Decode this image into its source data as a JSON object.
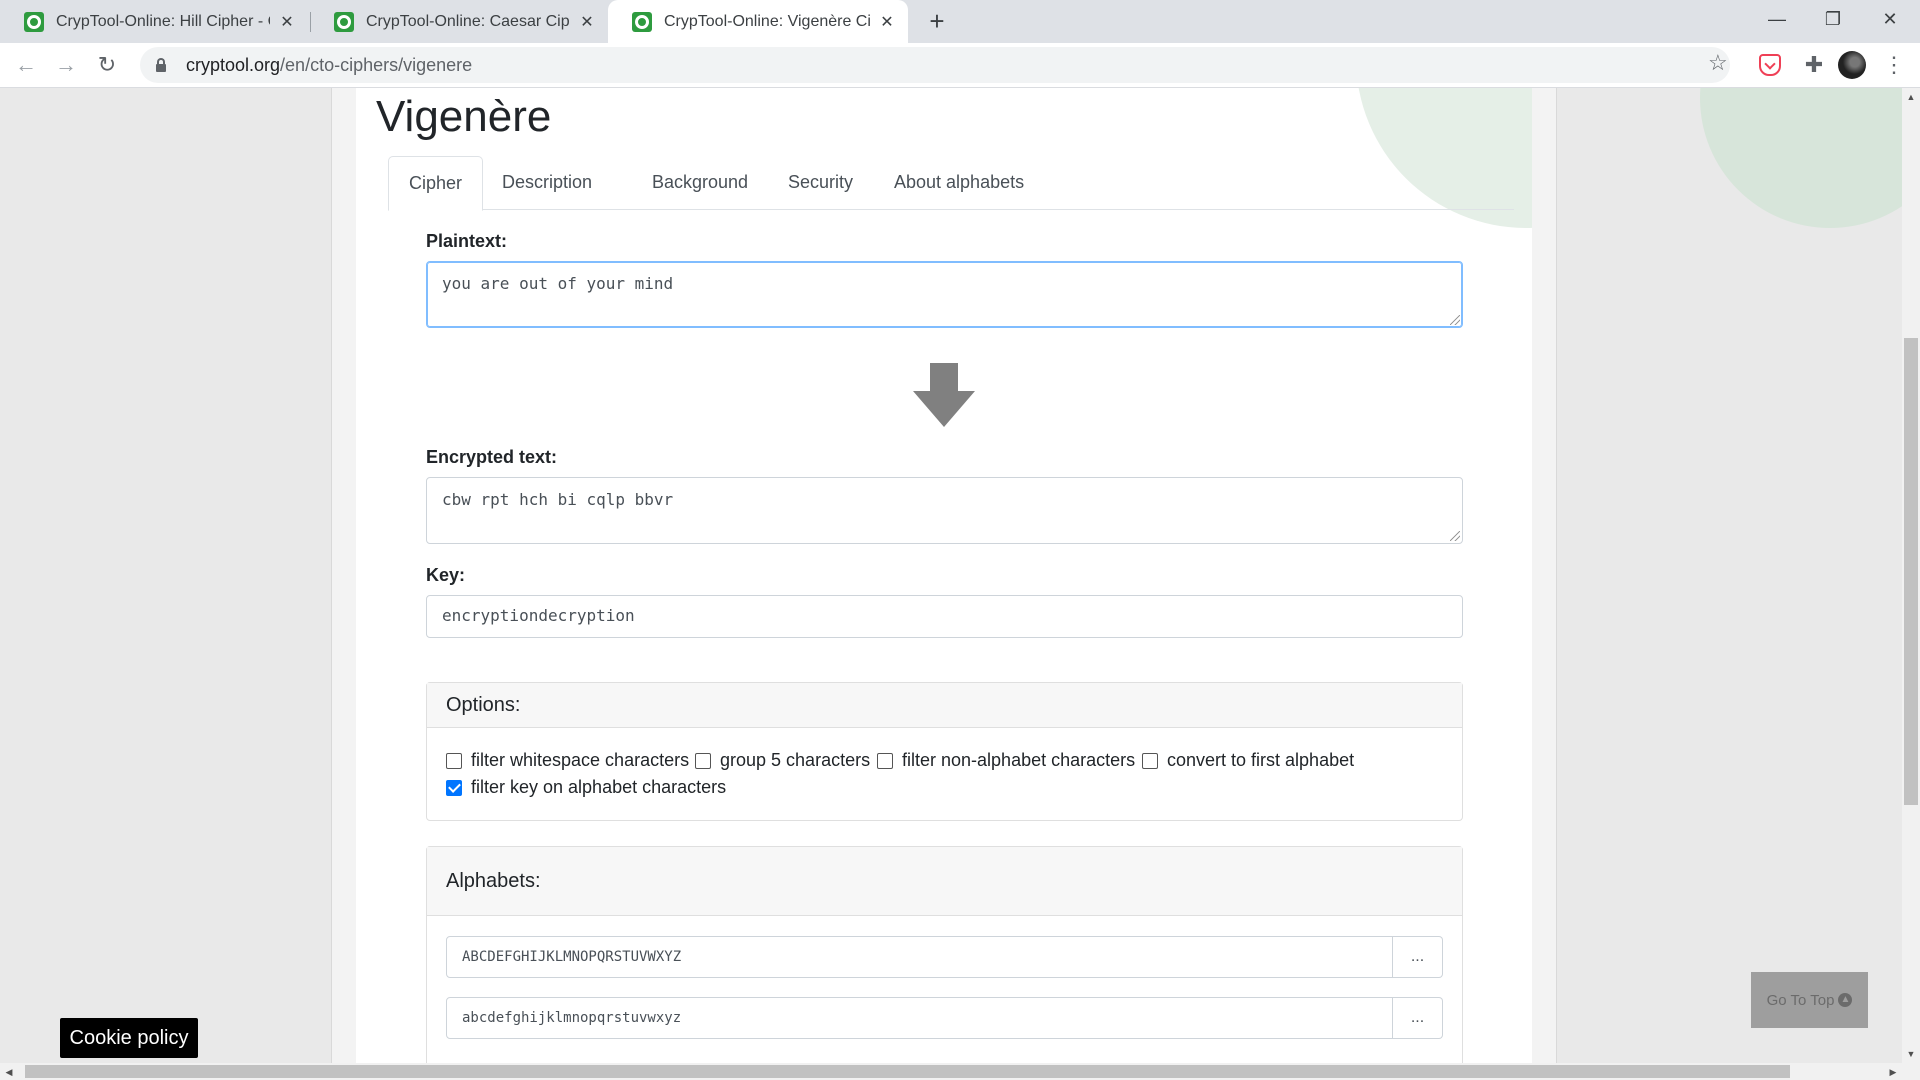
{
  "browser": {
    "tabs": [
      {
        "title": "CrypTool-Online: Hill Cipher - Cry"
      },
      {
        "title": "CrypTool-Online: Caesar Cipher -"
      },
      {
        "title": "CrypTool-Online: Vigenère Ciphe"
      }
    ],
    "new_tab": "+",
    "url_host": "cryptool.org",
    "url_path": "/en/cto-ciphers/vigenere",
    "window_controls": {
      "minimize": "—",
      "restore": "❐",
      "close": "✕"
    }
  },
  "page": {
    "heading": "Vigenère",
    "tabs": [
      "Cipher",
      "Description",
      "Background",
      "Security",
      "About alphabets"
    ],
    "plaintext": {
      "label": "Plaintext:",
      "value": "you are out of your mind"
    },
    "encrypted": {
      "label": "Encrypted text:",
      "value": "cbw rpt hch bi cqlp bbvr"
    },
    "key": {
      "label": "Key:",
      "value": "encryptiondecryption"
    },
    "options": {
      "title": "Options:",
      "items": [
        {
          "label": "filter whitespace characters",
          "checked": false
        },
        {
          "label": "group 5 characters",
          "checked": false
        },
        {
          "label": "filter non-alphabet characters",
          "checked": false
        },
        {
          "label": "convert to first alphabet",
          "checked": false
        },
        {
          "label": "filter key on alphabet characters",
          "checked": true
        }
      ]
    },
    "alphabets": {
      "title": "Alphabets:",
      "rows": [
        {
          "value": "ABCDEFGHIJKLMNOPQRSTUVWXYZ",
          "button": "..."
        },
        {
          "value": "abcdefghijklmnopqrstuvwxyz",
          "button": "..."
        }
      ]
    },
    "go_to_top": "Go To Top",
    "cookie_policy": "Cookie policy"
  },
  "icons": {
    "back": "arrow-left-icon",
    "forward": "arrow-right-icon",
    "reload": "reload-icon",
    "lock": "lock-icon",
    "star": "star-icon",
    "pocket": "pocket-icon",
    "extensions": "puzzle-icon",
    "menu": "kebab-menu-icon",
    "arrow": "down-arrow-icon"
  },
  "colors": {
    "favicon": "#2e9b3f",
    "checkbox_checked": "#0075ff",
    "focus_border": "#80bdff"
  }
}
